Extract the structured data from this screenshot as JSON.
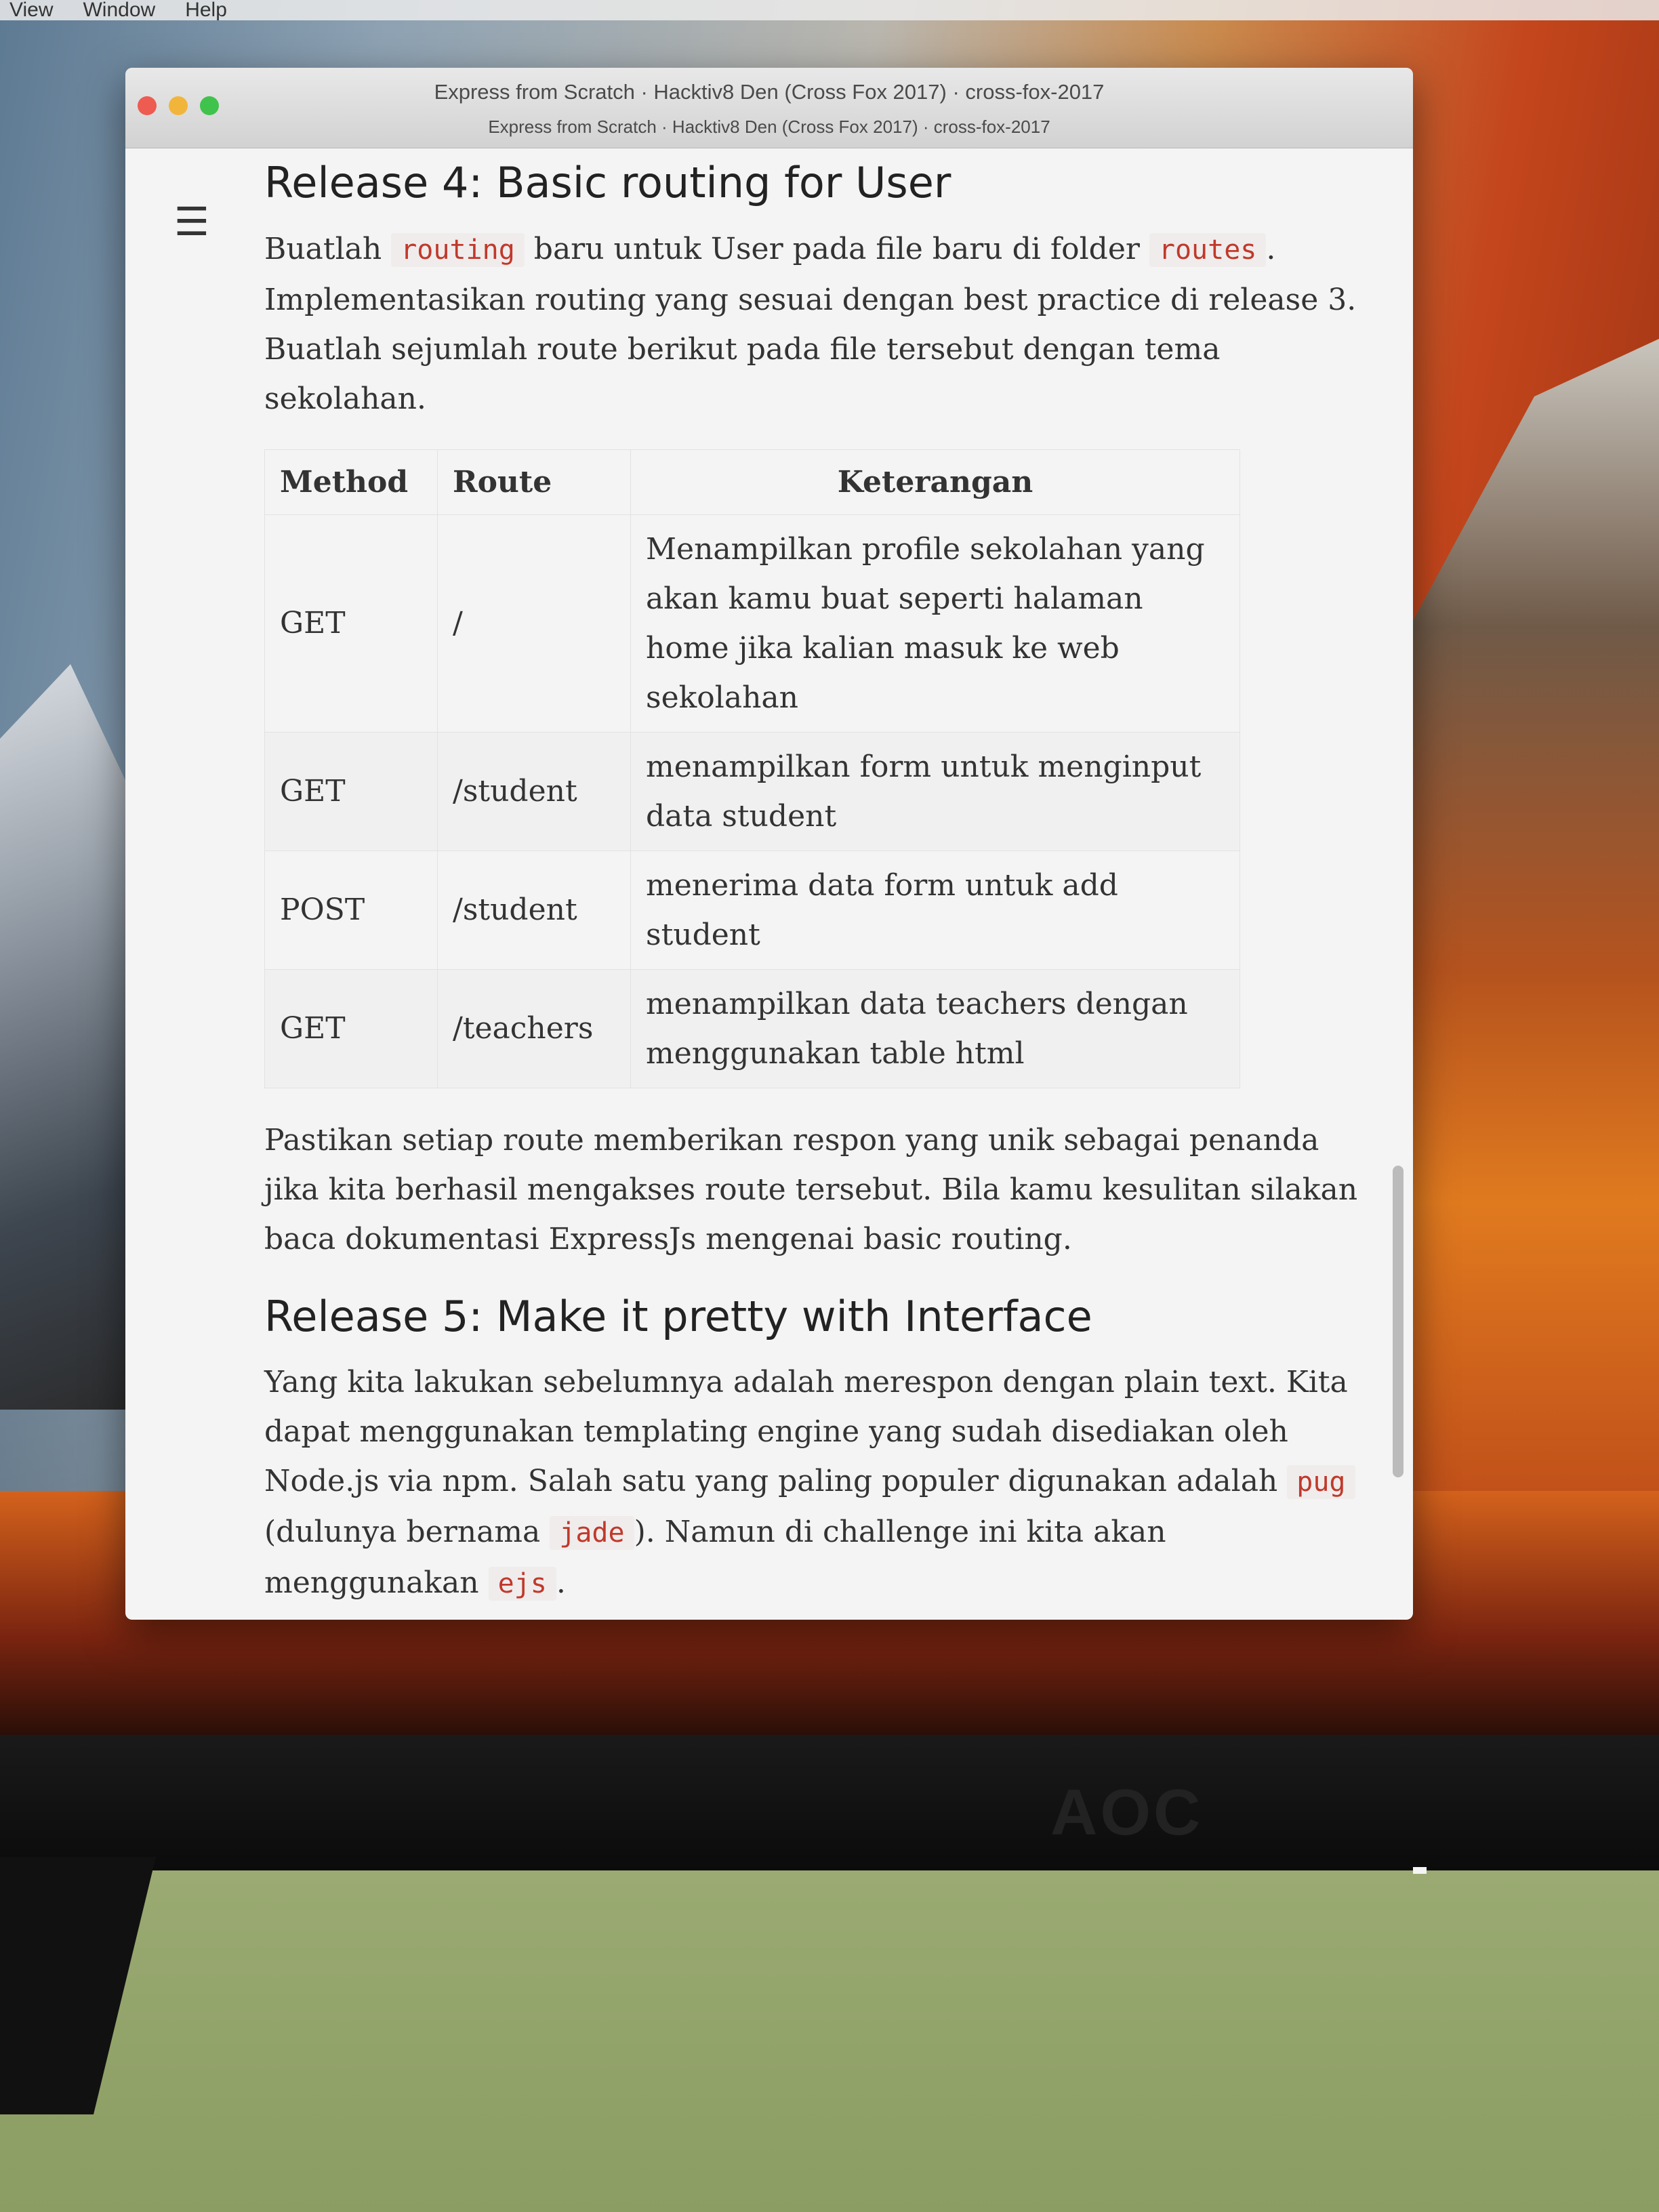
{
  "menubar": {
    "items": [
      "View",
      "Window",
      "Help"
    ]
  },
  "window": {
    "title": "Express from Scratch · Hacktiv8 Den (Cross Fox 2017) · cross-fox-2017",
    "subtitle": "Express from Scratch · Hacktiv8 Den (Cross Fox 2017) · cross-fox-2017"
  },
  "release4": {
    "heading": "Release 4: Basic routing for User",
    "p1_a": "Buatlah ",
    "p1_code1": "routing",
    "p1_b": " baru untuk User pada file baru di folder ",
    "p1_code2": "routes",
    "p1_c": ". Implementasikan routing yang sesuai dengan best practice di release 3. Buatlah sejumlah route berikut pada file tersebut dengan tema sekolahan.",
    "table": {
      "headers": [
        "Method",
        "Route",
        "Keterangan"
      ],
      "rows": [
        {
          "method": "GET",
          "route": "/",
          "desc": "Menampilkan profile sekolahan yang akan kamu buat seperti halaman home jika kalian masuk ke web sekolahan"
        },
        {
          "method": "GET",
          "route": "/student",
          "desc": "menampilkan form untuk menginput data student"
        },
        {
          "method": "POST",
          "route": "/student",
          "desc": "menerima data form untuk add student"
        },
        {
          "method": "GET",
          "route": "/teachers",
          "desc": "menampilkan data teachers dengan menggunakan table html"
        }
      ]
    },
    "p2": "Pastikan setiap route memberikan respon yang unik sebagai penanda jika kita berhasil mengakses route tersebut. Bila kamu kesulitan silakan baca dokumentasi ExpressJs mengenai basic routing."
  },
  "release5": {
    "heading": "Release 5: Make it pretty with Interface",
    "p_a": "Yang kita lakukan sebelumnya adalah merespon dengan plain text. Kita dapat menggunakan templating engine yang sudah disediakan oleh Node.js via npm. Salah satu yang paling populer digunakan adalah ",
    "p_code1": "pug",
    "p_b": " (dulunya bernama ",
    "p_code2": "jade",
    "p_c": "). Namun di challenge ini kita akan menggunakan ",
    "p_code3": "ejs",
    "p_d": "."
  },
  "monitor": {
    "brand": "AOC"
  },
  "icons": {
    "menu": "hamburger-menu-icon"
  }
}
